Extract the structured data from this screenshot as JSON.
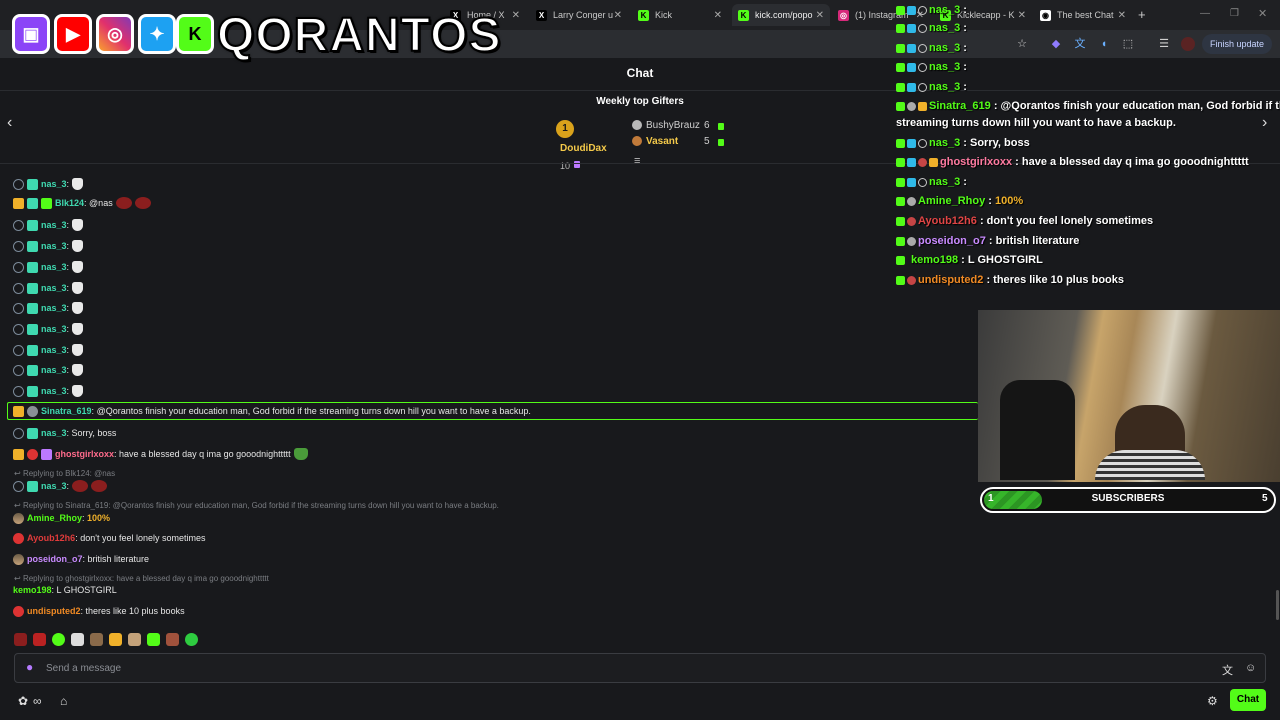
{
  "browser": {
    "tabs": [
      {
        "title": "Home / X",
        "icon": "x-icon"
      },
      {
        "title": "Larry Conger u",
        "icon": "x-icon"
      },
      {
        "title": "Kick",
        "icon": "kick-icon"
      },
      {
        "title": "kick.com/popo",
        "icon": "kick-icon"
      },
      {
        "title": "(1) Instagram",
        "icon": "instagram-icon"
      },
      {
        "title": "Kicklecapp - K",
        "icon": "kick-icon"
      },
      {
        "title": "The best Chat",
        "icon": "chat-icon"
      }
    ],
    "finish_update": "Finish update"
  },
  "overlay": {
    "logo_text": "QORANTOS"
  },
  "chat": {
    "title": "Chat",
    "gifters_title": "Weekly top Gifters",
    "top_gifter": {
      "rank": "1",
      "name": "DoudiDax",
      "count": "10"
    },
    "gifters": [
      {
        "name": "BushyBrauz",
        "count": "6"
      },
      {
        "name": "Vasant",
        "count": "5"
      }
    ],
    "messages": [
      {
        "user": "nas_3",
        "color": "#3fd9b0",
        "text": ""
      },
      {
        "user": "Blk124",
        "color": "#3fd9b0",
        "text": "@nas"
      },
      {
        "user": "nas_3",
        "color": "#3fd9b0",
        "text": ""
      },
      {
        "user": "nas_3",
        "color": "#3fd9b0",
        "text": ""
      },
      {
        "user": "nas_3",
        "color": "#3fd9b0",
        "text": ""
      },
      {
        "user": "nas_3",
        "color": "#3fd9b0",
        "text": ""
      },
      {
        "user": "nas_3",
        "color": "#3fd9b0",
        "text": ""
      },
      {
        "user": "nas_3",
        "color": "#3fd9b0",
        "text": ""
      },
      {
        "user": "nas_3",
        "color": "#3fd9b0",
        "text": ""
      },
      {
        "user": "nas_3",
        "color": "#3fd9b0",
        "text": ""
      },
      {
        "user": "nas_3",
        "color": "#3fd9b0",
        "text": ""
      },
      {
        "user": "Sinatra_619",
        "color": "#3fd9b0",
        "text": "@Qorantos finish your education man, God forbid if the streaming turns down hill you want to have a backup."
      },
      {
        "user": "nas_3",
        "color": "#3fd9b0",
        "text": "Sorry, boss"
      },
      {
        "user": "ghostgirlxoxx",
        "color": "#ff6b8b",
        "text": "have a blessed day q ima go gooodnighttttt"
      },
      {
        "user": "nas_3",
        "color": "#3fd9b0",
        "text": ""
      },
      {
        "user": "Amine_Rhoy",
        "color": "#53fc18",
        "text": "100%"
      },
      {
        "user": "Ayoub12h6",
        "color": "#e03b3b",
        "text": "don't you feel lonely sometimes"
      },
      {
        "user": "poseidon_o7",
        "color": "#c98bff",
        "text": "british literature"
      },
      {
        "user": "kemo198",
        "color": "#53fc18",
        "text": "L GHOSTGIRL"
      },
      {
        "user": "undisputed2",
        "color": "#f08a24",
        "text": "theres like 10 plus books"
      }
    ],
    "replies": [
      "Replying to Blk124: @nas",
      "Replying to Sinatra_619: @Qorantos finish your education man, God forbid if the streaming turns down hill you want to have a backup.",
      "Replying to ghostgirlxoxx: have a blessed day q ima go gooodnighttttt"
    ],
    "input_placeholder": "Send a message",
    "send_label": "Chat"
  },
  "overlay_chat": [
    {
      "user": "nas_3",
      "color": "#53fc18",
      "text": ""
    },
    {
      "user": "nas_3",
      "color": "#53fc18",
      "text": ""
    },
    {
      "user": "nas_3",
      "color": "#53fc18",
      "text": ""
    },
    {
      "user": "nas_3",
      "color": "#53fc18",
      "text": ""
    },
    {
      "user": "nas_3",
      "color": "#53fc18",
      "text": ""
    },
    {
      "user": "Sinatra_619",
      "color": "#53fc18",
      "text": "@Qorantos finish your education man, God forbid if the",
      "text2": "streaming turns down hill you want to have a backup."
    },
    {
      "user": "nas_3",
      "color": "#53fc18",
      "text": "Sorry, boss"
    },
    {
      "user": "ghostgirlxoxx",
      "color": "#ff7aa0",
      "text": "have a blessed day q ima go gooodnighttttt"
    },
    {
      "user": "nas_3",
      "color": "#53fc18",
      "text": ""
    },
    {
      "user": "Amine_Rhoy",
      "color": "#53fc18",
      "text": "100%"
    },
    {
      "user": "Ayoub12h6",
      "color": "#e04545",
      "text": "don't you feel lonely sometimes"
    },
    {
      "user": "poseidon_o7",
      "color": "#c98bff",
      "text": "british literature"
    },
    {
      "user": "kemo198",
      "color": "#53fc18",
      "text": "L GHOSTGIRL"
    },
    {
      "user": "undisputed2",
      "color": "#f08a24",
      "text": "theres like 10 plus books"
    }
  ],
  "subs_goal": {
    "current": "1",
    "label": "SUBSCRIBERS",
    "target": "5",
    "progress": 0.2
  }
}
